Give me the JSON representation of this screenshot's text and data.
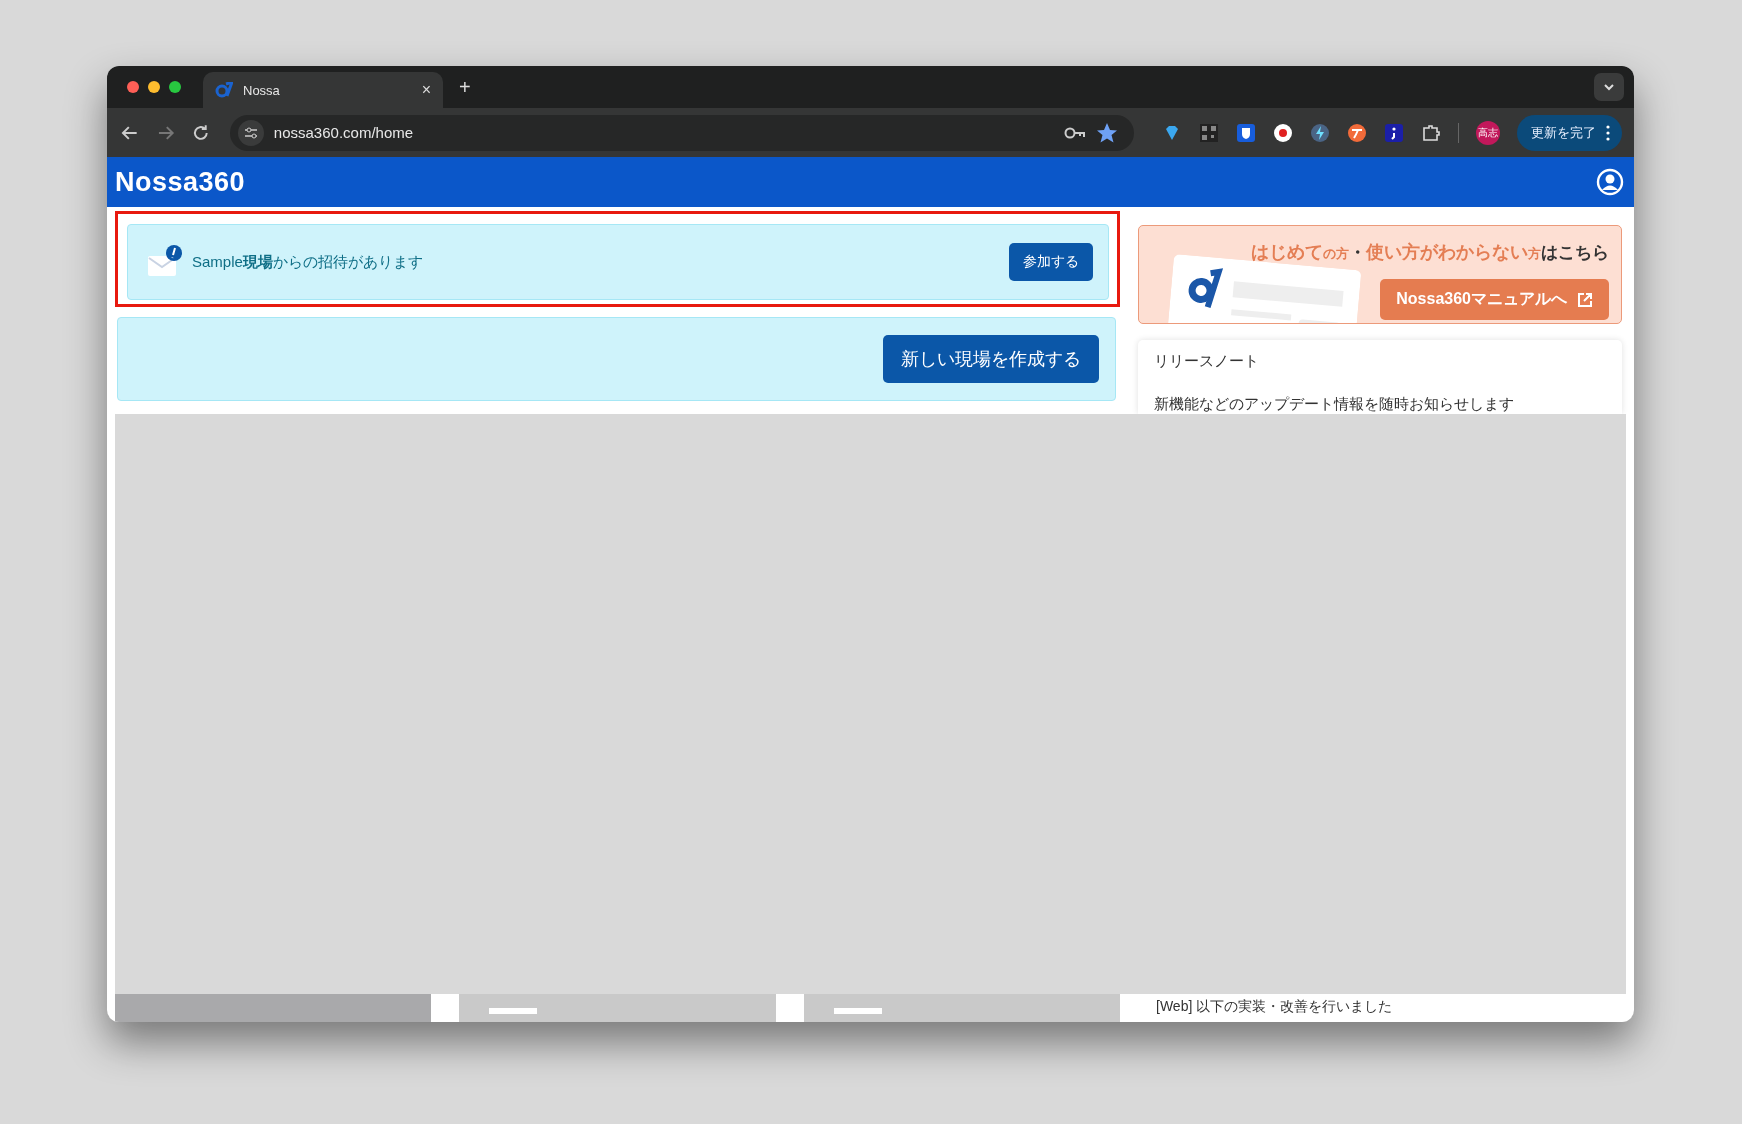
{
  "browser": {
    "tab": {
      "title": "Nossa",
      "close": "×"
    },
    "new_tab": "+",
    "url": "nossa360.com/home",
    "profile": "高志",
    "update_button": "更新を完了"
  },
  "header": {
    "logo": "Nossa",
    "logo_suffix": "360"
  },
  "invitation": {
    "message": "Sample**現場**からの招待があります",
    "button": "参加する"
  },
  "create_button": "新しい現場を作成する",
  "manual_banner": {
    "headline": [
      {
        "kind": "accent",
        "text": "はじめて"
      },
      {
        "kind": "small",
        "text": "の方"
      },
      {
        "kind": "plain",
        "text": "・"
      },
      {
        "kind": "accent",
        "text": "使い方がわからない"
      },
      {
        "kind": "small",
        "text": "方"
      },
      {
        "kind": "plain",
        "text": "はこちら"
      }
    ],
    "button": "Nossa360マニュアルへ"
  },
  "release_notes": {
    "title": "リリースノート",
    "intro": "新機能などのアップデート情報を随時お知らせします",
    "entry": "[Web] 以下の実装・改善を行いました"
  }
}
